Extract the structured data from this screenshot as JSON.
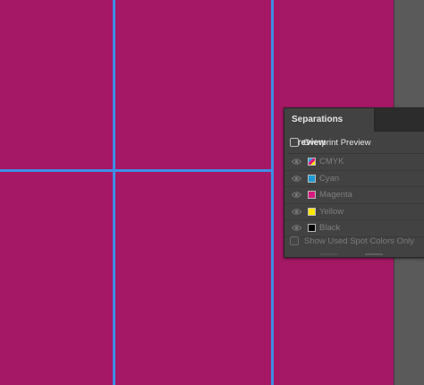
{
  "canvas": {
    "artboard_color": "#a51865",
    "guide_color": "#3d8ee6"
  },
  "panel": {
    "tab_label": "Separations Preview",
    "overprint_label": "Overprint Preview",
    "overprint_checked": false,
    "separations": [
      {
        "name": "CMYK",
        "color": "cmyk",
        "icon": "eye-icon"
      },
      {
        "name": "Cyan",
        "color": "#1e9ad6",
        "icon": "eye-icon"
      },
      {
        "name": "Magenta",
        "color": "#d6197d",
        "icon": "eye-icon"
      },
      {
        "name": "Yellow",
        "color": "#ffe800",
        "icon": "eye-icon"
      },
      {
        "name": "Black",
        "color": "#000000",
        "icon": "eye-icon"
      }
    ],
    "spot_label": "Show Used Spot Colors Only",
    "spot_checked": false
  }
}
